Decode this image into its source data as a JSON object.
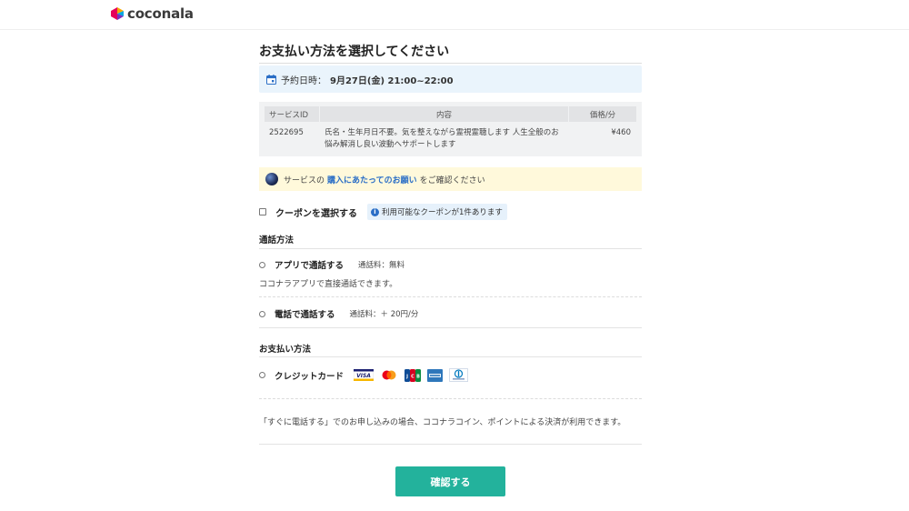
{
  "header": {
    "brand": "coconala",
    "logo_icon": "coconala-logo-icon",
    "logo_colors": [
      "#f6a800",
      "#e6005a",
      "#7b2fbe",
      "#00a7e1"
    ]
  },
  "page": {
    "title": "お支払い方法を選択してください"
  },
  "schedule": {
    "icon": "calendar-icon",
    "label": "予約日時：",
    "value": "9月27日(金) 21:00~22:00"
  },
  "service_table": {
    "headers": [
      "サービスID",
      "内容",
      "価格/分"
    ],
    "rows": [
      [
        "2522695",
        "氏名・生年月日不要。気を整えながら霊視霊聴します 人生全般のお悩み解消し良い波動へサポートします",
        "¥460"
      ]
    ]
  },
  "notice": {
    "prefix": "サービスの",
    "link": "購入にあたってのお願い",
    "suffix": "をご確認ください"
  },
  "coupon": {
    "label": "クーポンを選択する",
    "info": "利用可能なクーポンが1件あります",
    "info_icon": "info-icon"
  },
  "call_method": {
    "title": "通話方法",
    "options": [
      {
        "label": "アプリで通話する",
        "fee": "通話料：無料",
        "desc": "ココナラアプリで直接通話できます。"
      },
      {
        "label": "電話で通話する",
        "fee": "通話料：＋ 20円/分"
      }
    ]
  },
  "payment": {
    "title": "お支払い方法",
    "option_label": "クレジットカード",
    "cards": [
      "visa-icon",
      "mastercard-icon",
      "jcb-icon",
      "amex-icon",
      "diners-icon"
    ],
    "note": "「すぐに電話する」でのお申し込みの場合、ココナラコイン、ポイントによる決済が利用できます。"
  },
  "confirm": {
    "label": "確認する",
    "color": "#23b29c"
  },
  "colors": {
    "link": "#2a6ec6",
    "schedule_bg": "#eaf4fc",
    "notice_bg": "#fff9db"
  }
}
